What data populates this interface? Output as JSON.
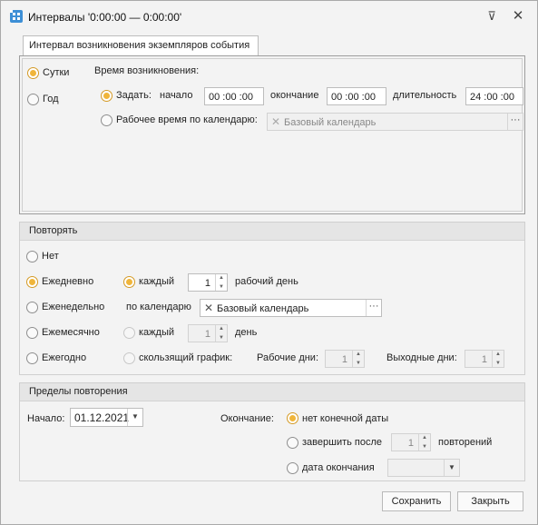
{
  "window": {
    "title": "Интервалы '0:00:00 — 0:00:00'"
  },
  "tab": {
    "label": "Интервал возникновения экземпляров события"
  },
  "occurrence": {
    "mode_day": "Сутки",
    "mode_year": "Год",
    "time_header": "Время возникновения:",
    "set_label": "Задать:",
    "start_label": "начало",
    "start_value": "00 :00 :00",
    "end_label": "окончание",
    "end_value": "00 :00 :00",
    "duration_label": "длительность",
    "duration_value": "24 :00 :00",
    "calendar_label": "Рабочее время по календарю:",
    "calendar_value": "Базовый календарь"
  },
  "repeat": {
    "header": "Повторять",
    "none": "Нет",
    "daily": "Ежедневно",
    "weekly": "Еженедельно",
    "monthly": "Ежемесячно",
    "yearly": "Ежегодно",
    "each1": "каждый",
    "each1_value": "1",
    "workday": "рабочий день",
    "by_calendar": "по календарю",
    "calendar_value": "Базовый календарь",
    "each2": "каждый",
    "each2_value": "1",
    "day": "день",
    "sliding": "скользящий график:",
    "work_days_label": "Рабочие дни:",
    "work_days_value": "1",
    "off_days_label": "Выходные дни:",
    "off_days_value": "1"
  },
  "limits": {
    "header": "Пределы повторения",
    "start_label": "Начало:",
    "start_value": "01.12.2021",
    "end_label": "Окончание:",
    "no_end": "нет конечной даты",
    "end_after": "завершить после",
    "end_after_value": "1",
    "repeats": "повторений",
    "end_date": "дата окончания"
  },
  "buttons": {
    "save": "Сохранить",
    "close": "Закрыть"
  }
}
